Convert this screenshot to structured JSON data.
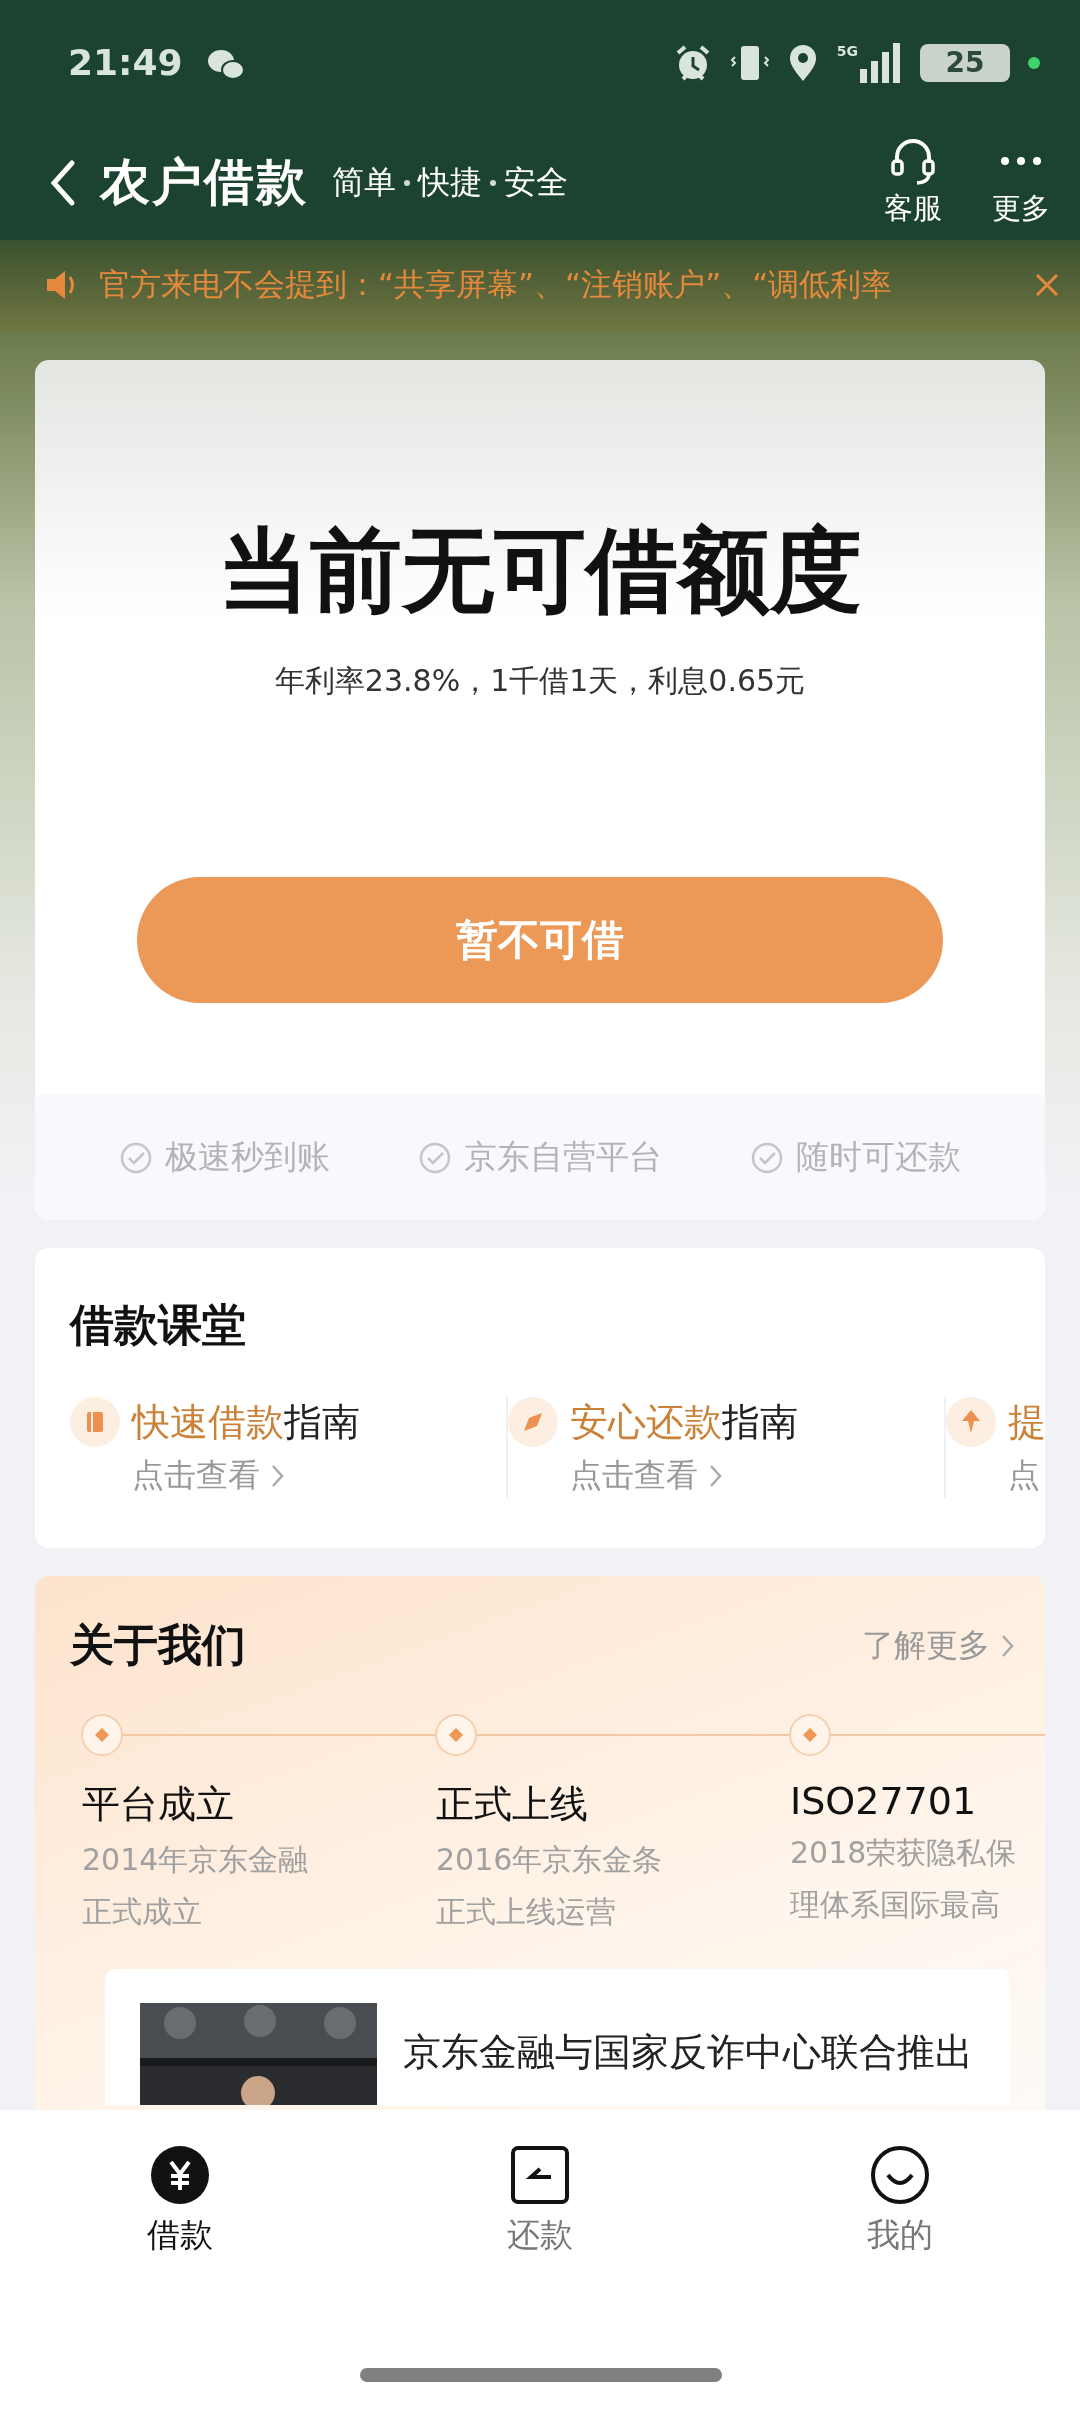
{
  "status_bar": {
    "time": "21:49",
    "battery": "25",
    "network": "5G"
  },
  "header": {
    "title": "农户借款",
    "slogan": [
      "简单",
      "快捷",
      "安全"
    ],
    "actions": [
      {
        "label": "客服"
      },
      {
        "label": "更多"
      }
    ]
  },
  "notice": {
    "text": "官方来电不会提到：“共享屏幕”、“注销账户”、“调低利率"
  },
  "quota_card": {
    "title": "当前无可借额度",
    "rate": "年利率23.8%，1千借1天，利息0.65元",
    "button": {
      "label": "暂不可借",
      "disabled": true
    },
    "features": [
      "极速秒到账",
      "京东自营平台",
      "随时可还款"
    ]
  },
  "course": {
    "title": "借款课堂",
    "items": [
      {
        "highlight": "快速借款",
        "suffix": "指南",
        "link": "点击查看",
        "chevron": true
      },
      {
        "highlight": "安心还款",
        "suffix": "指南",
        "link": "点击查看",
        "chevron": true
      },
      {
        "highlight": "提",
        "link": "点",
        "chevron": false
      }
    ]
  },
  "about": {
    "title": "关于我们",
    "more": "了解更多",
    "milestones": [
      {
        "title": "平台成立",
        "desc": [
          "2014年京东金融",
          "正式成立"
        ]
      },
      {
        "title": "正式上线",
        "desc": [
          "2016年京东金条",
          "正式上线运营"
        ]
      },
      {
        "title": "ISO27701",
        "desc": [
          "2018荣获隐私保",
          "理体系国际最高"
        ]
      }
    ],
    "news": {
      "text": "京东金融与国家反诈中心联合推出"
    }
  },
  "tabs": [
    {
      "label": "借款",
      "selected": true
    },
    {
      "label": "还款",
      "selected": false
    },
    {
      "label": "我的",
      "selected": false
    }
  ]
}
